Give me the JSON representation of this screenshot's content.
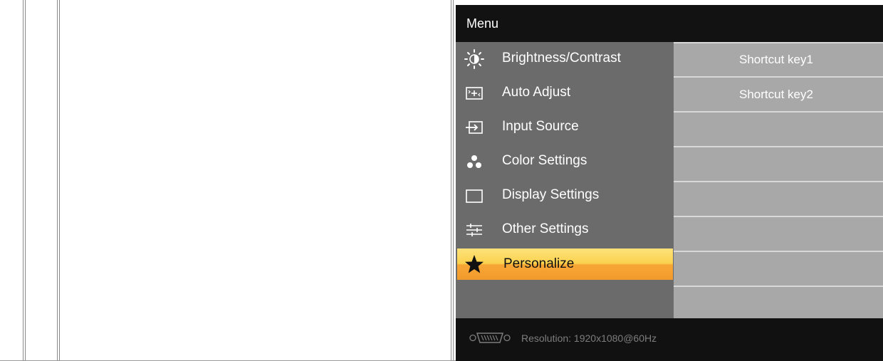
{
  "osd": {
    "title": "Menu",
    "menu_items": [
      {
        "label": "Brightness/Contrast",
        "icon": "brightness-icon"
      },
      {
        "label": "Auto Adjust",
        "icon": "auto-adjust-icon"
      },
      {
        "label": "Input Source",
        "icon": "input-source-icon"
      },
      {
        "label": "Color Settings",
        "icon": "color-settings-icon"
      },
      {
        "label": "Display Settings",
        "icon": "display-settings-icon"
      },
      {
        "label": "Other Settings",
        "icon": "other-settings-icon"
      },
      {
        "label": "Personalize",
        "icon": "star-icon",
        "selected": true
      }
    ],
    "submenu_items": [
      {
        "label": "Shortcut key1"
      },
      {
        "label": "Shortcut key2"
      },
      {
        "label": ""
      },
      {
        "label": ""
      },
      {
        "label": ""
      },
      {
        "label": ""
      },
      {
        "label": ""
      }
    ],
    "footer": {
      "icon": "vga-connector-icon",
      "resolution_text": "Resolution:  1920x1080@60Hz"
    },
    "colors": {
      "selected_top": "#fde27a",
      "selected_bottom": "#f29a2c",
      "menu_bg": "#6b6b6b",
      "submenu_bg": "#a8a8a8",
      "header_bg": "#121212"
    }
  }
}
